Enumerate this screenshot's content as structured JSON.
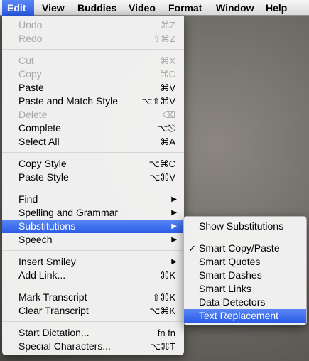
{
  "menubar": {
    "items": [
      "Edit",
      "View",
      "Buddies",
      "Video",
      "Format",
      "Window",
      "Help"
    ]
  },
  "edit_menu": {
    "undo": {
      "label": "Undo",
      "shortcut": "⌘Z"
    },
    "redo": {
      "label": "Redo",
      "shortcut": "⇧⌘Z"
    },
    "cut": {
      "label": "Cut",
      "shortcut": "⌘X"
    },
    "copy": {
      "label": "Copy",
      "shortcut": "⌘C"
    },
    "paste": {
      "label": "Paste",
      "shortcut": "⌘V"
    },
    "paste_match": {
      "label": "Paste and Match Style",
      "shortcut": "⌥⇧⌘V"
    },
    "delete": {
      "label": "Delete",
      "shortcut": "⌫"
    },
    "complete": {
      "label": "Complete",
      "shortcut": "⌥⎋"
    },
    "select_all": {
      "label": "Select All",
      "shortcut": "⌘A"
    },
    "copy_style": {
      "label": "Copy Style",
      "shortcut": "⌥⌘C"
    },
    "paste_style": {
      "label": "Paste Style",
      "shortcut": "⌥⌘V"
    },
    "find": {
      "label": "Find"
    },
    "spelling": {
      "label": "Spelling and Grammar"
    },
    "substitutions": {
      "label": "Substitutions"
    },
    "speech": {
      "label": "Speech"
    },
    "insert_smiley": {
      "label": "Insert Smiley"
    },
    "add_link": {
      "label": "Add Link...",
      "shortcut": "⌘K"
    },
    "mark_transcript": {
      "label": "Mark Transcript",
      "shortcut": "⇧⌘K"
    },
    "clear_transcript": {
      "label": "Clear Transcript",
      "shortcut": "⌥⌘K"
    },
    "start_dictation": {
      "label": "Start Dictation...",
      "shortcut": "fn fn"
    },
    "special_chars": {
      "label": "Special Characters...",
      "shortcut": "⌥⌘T"
    }
  },
  "substitutions_menu": {
    "show": "Show Substitutions",
    "smart_copy_paste": "Smart Copy/Paste",
    "smart_quotes": "Smart Quotes",
    "smart_dashes": "Smart Dashes",
    "smart_links": "Smart Links",
    "data_detectors": "Data Detectors",
    "text_replacement": "Text Replacement",
    "check": "✓"
  },
  "icons": {
    "submenu_arrow": "▶"
  }
}
